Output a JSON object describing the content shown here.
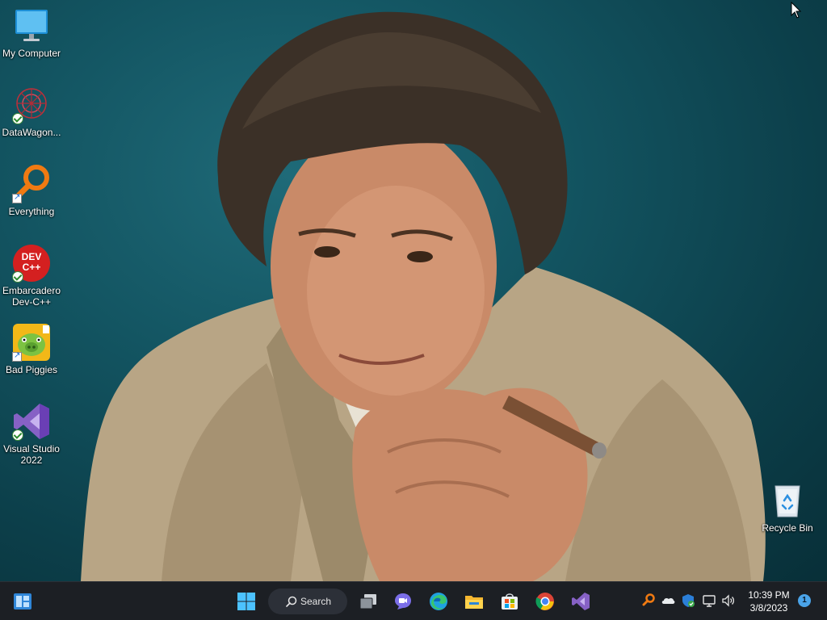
{
  "desktop": {
    "icons": [
      {
        "label": "My Computer"
      },
      {
        "label": "DataWagon..."
      },
      {
        "label": "Everything"
      },
      {
        "label": "Embarcadero Dev-C++"
      },
      {
        "label": "Bad Piggies"
      },
      {
        "label": "Visual Studio 2022"
      },
      {
        "label": "Recycle Bin"
      }
    ],
    "devcpp_icon_text": "DEV C++"
  },
  "taskbar": {
    "search_label": "Search",
    "apps": [
      "start-icon",
      "search-icon",
      "task-view-icon",
      "teams-chat-icon",
      "edge-icon",
      "file-explorer-icon",
      "store-icon",
      "chrome-icon",
      "visual-studio-icon"
    ],
    "tray": [
      "everything-search-icon",
      "onedrive-icon",
      "defender-icon",
      "network-icon",
      "volume-icon"
    ],
    "time": "10:39 PM",
    "date": "3/8/2023",
    "notification_count": "1"
  }
}
